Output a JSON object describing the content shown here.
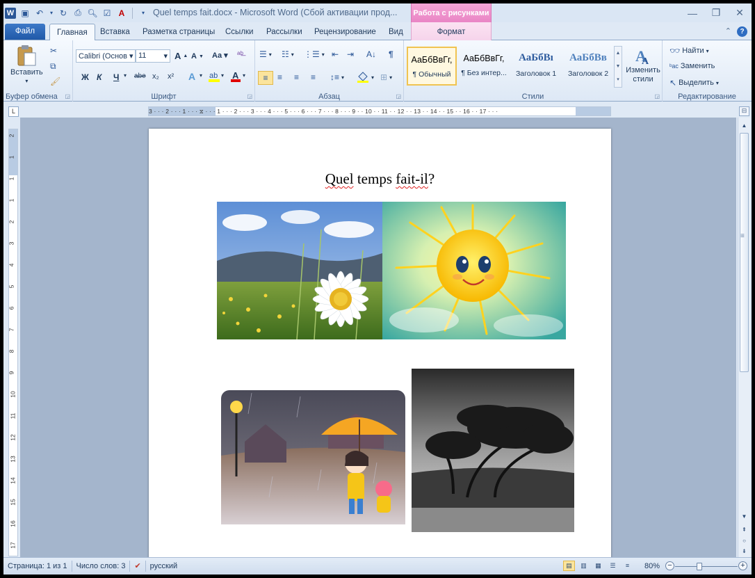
{
  "window": {
    "title": "Quel temps fait.docx - Microsoft Word (Сбой активации прод...",
    "context_tab_group": "Работа с рисунками",
    "context_tab": "Формат"
  },
  "tabs": {
    "file": "Файл",
    "home": "Главная",
    "insert": "Вставка",
    "layout": "Разметка страницы",
    "refs": "Ссылки",
    "mailings": "Рассылки",
    "review": "Рецензирование",
    "view": "Вид"
  },
  "ribbon": {
    "clipboard": {
      "label": "Буфер обмена",
      "paste": "Вставить"
    },
    "font": {
      "label": "Шрифт",
      "family": "Calibri (Основ",
      "size": "11",
      "bold": "Ж",
      "italic": "К",
      "underline": "Ч",
      "strike": "abe",
      "sub": "x₂",
      "sup": "x²",
      "grow": "A",
      "shrink": "A",
      "case": "Aa"
    },
    "paragraph": {
      "label": "Абзац"
    },
    "styles": {
      "label": "Стили",
      "items": [
        {
          "sample": "АаБбВвГг,",
          "name": "¶ Обычный"
        },
        {
          "sample": "АаБбВвГг,",
          "name": "¶ Без интер..."
        },
        {
          "sample": "АаБбВı",
          "name": "Заголовок 1"
        },
        {
          "sample": "АаБбВв",
          "name": "Заголовок 2"
        }
      ],
      "change": "Изменить стили"
    },
    "editing": {
      "label": "Редактирование",
      "find": "Найти",
      "replace": "Заменить",
      "select": "Выделить"
    }
  },
  "ruler": {
    "h": "3 · · · 2 · · · 1 · · · ⧖ · · · 1 · · · 2 · · · 3 · · · 4 · · · 5 · · · 6 · · · 7 · · · 8 · · · 9 · · 10 · · 11 · · 12 · · 13 · · 14 · · 15 · · 16 · · 17 · · ·",
    "corner": "L",
    "v": [
      "2",
      "1",
      "1",
      "1",
      "2",
      "3",
      "4",
      "5",
      "6",
      "7",
      "8",
      "9",
      "10",
      "11",
      "12",
      "13",
      "14",
      "15",
      "16",
      "17"
    ]
  },
  "document": {
    "title_words": [
      "Quel",
      "temps",
      "fait-il",
      "?"
    ]
  },
  "status": {
    "page": "Страница: 1 из 1",
    "words": "Число слов: 3",
    "language": "русский",
    "zoom": "80%",
    "zoom_percent": 80
  },
  "colors": {
    "file_tab": "#2b5797",
    "context_tab": "#e985c5",
    "accent": "#2b5797"
  }
}
